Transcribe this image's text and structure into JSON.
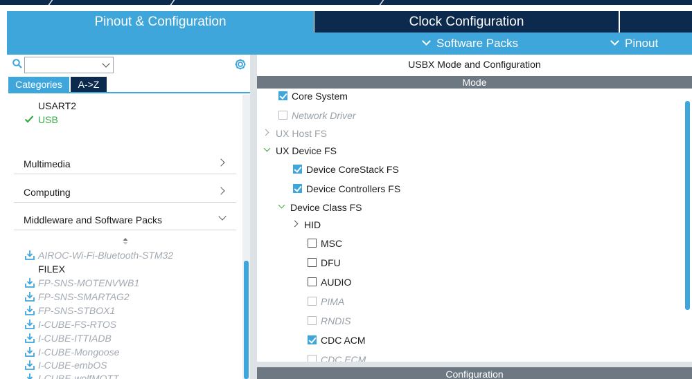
{
  "tabs": {
    "pinout": "Pinout & Configuration",
    "clock": "Clock Configuration"
  },
  "subnav": {
    "software_packs": "Software Packs",
    "pinout": "Pinout"
  },
  "left": {
    "search_value": "",
    "tab_categories": "Categories",
    "tab_az": "A->Z",
    "tree_items": [
      "USART2",
      "USB"
    ],
    "sections": [
      "Multimedia",
      "Computing",
      "Middleware and Software Packs"
    ],
    "packs": [
      {
        "label": "AIROC-Wi-Fi-Bluetooth-STM32",
        "installed": false
      },
      {
        "label": "FILEX",
        "installed": true
      },
      {
        "label": "FP-SNS-MOTENVWB1",
        "installed": false
      },
      {
        "label": "FP-SNS-SMARTAG2",
        "installed": false
      },
      {
        "label": "FP-SNS-STBOX1",
        "installed": false
      },
      {
        "label": "I-CUBE-FS-RTOS",
        "installed": false
      },
      {
        "label": "I-CUBE-ITTIADB",
        "installed": false
      },
      {
        "label": "I-CUBE-Mongoose",
        "installed": false
      },
      {
        "label": "I-CUBE-embOS",
        "installed": false
      },
      {
        "label": "I-CUBE-wolfMQTT",
        "installed": false
      }
    ]
  },
  "right": {
    "title": "USBX Mode and Configuration",
    "mode_header": "Mode",
    "config_header": "Configuration",
    "options": {
      "core_system": "Core System",
      "network_driver": "Network Driver",
      "ux_host_fs": "UX Host FS",
      "ux_device_fs": "UX Device FS",
      "device_corestack_fs": "Device CoreStack FS",
      "device_controllers_fs": "Device Controllers FS",
      "device_class_fs": "Device Class FS",
      "hid": "HID",
      "msc": "MSC",
      "dfu": "DFU",
      "audio": "AUDIO",
      "pima": "PIMA",
      "rndis": "RNDIS",
      "cdc_acm": "CDC ACM",
      "cdc_ecm": "CDC ECM"
    },
    "checked": {
      "core_system": true,
      "network_driver": false,
      "device_corestack_fs": true,
      "device_controllers_fs": true,
      "msc": false,
      "dfu": false,
      "audio": false,
      "pima": false,
      "rndis": false,
      "cdc_acm": true,
      "cdc_ecm": false
    }
  },
  "colors": {
    "accent": "#3fa6dc",
    "navy": "#0b2a4e",
    "enabled_green": "#3aa845",
    "header_grey": "#6d7882"
  },
  "icons": [
    "search-icon",
    "gear-icon",
    "check-icon",
    "chevron-down-icon",
    "chevron-right-icon",
    "download-icon",
    "sort-icon"
  ]
}
